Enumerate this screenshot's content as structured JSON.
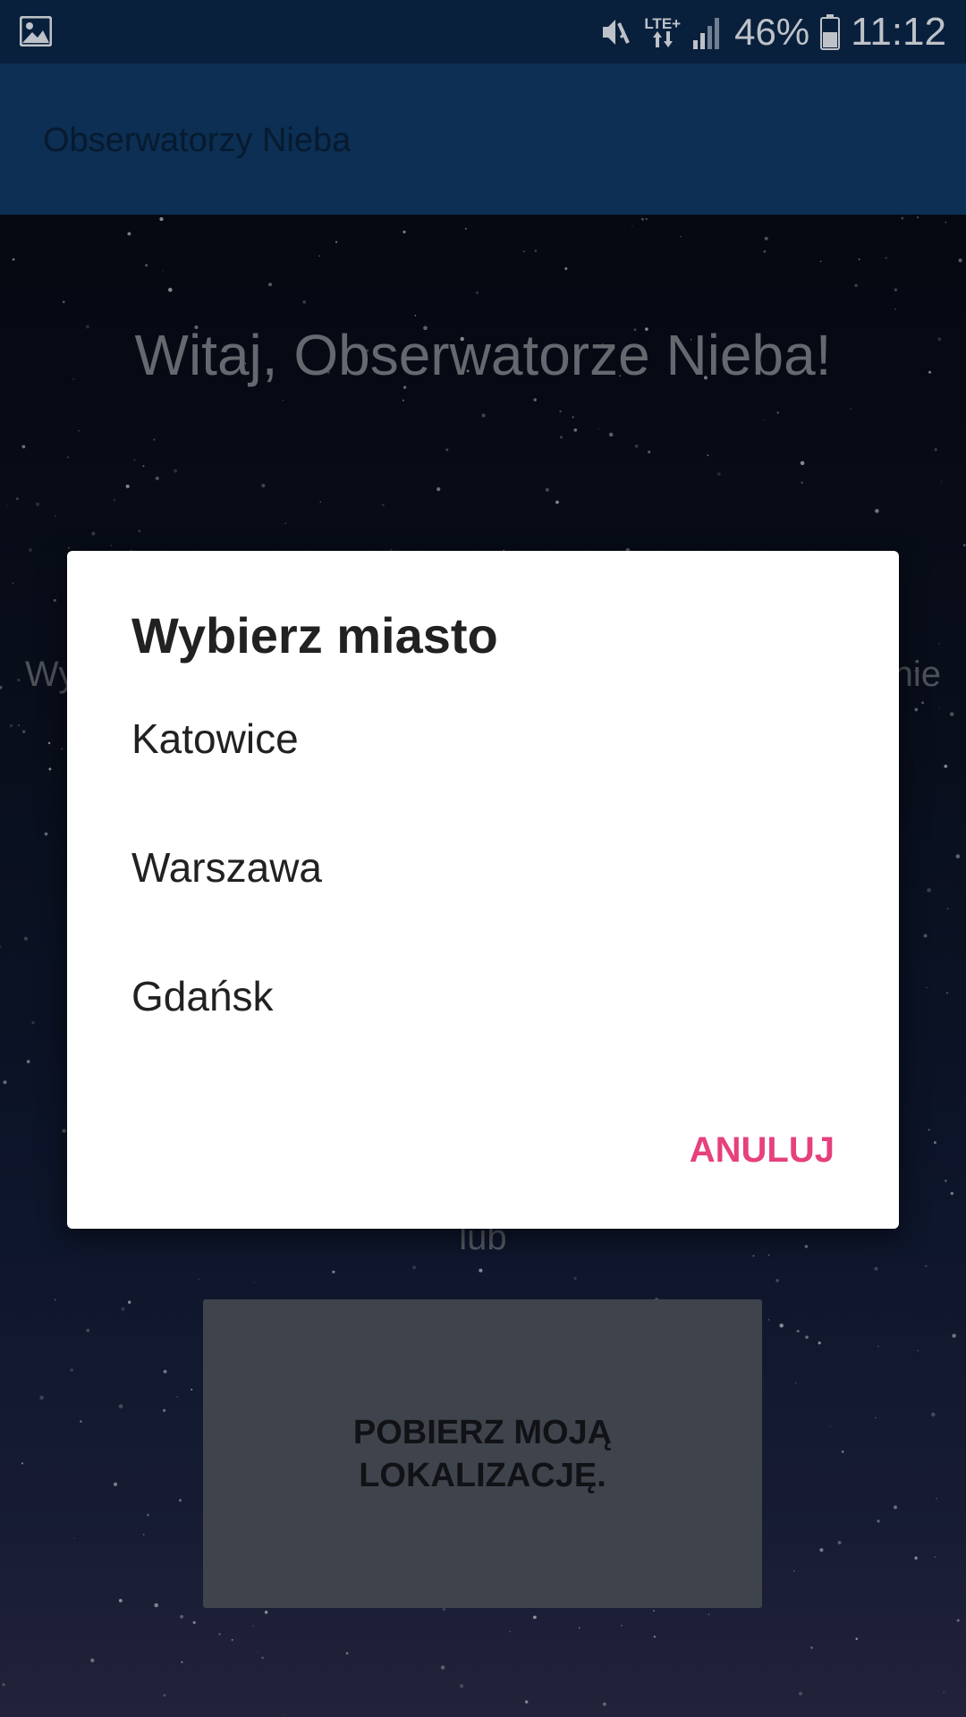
{
  "status_bar": {
    "network": "LTE+",
    "battery": "46%",
    "time": "11:12",
    "icons": [
      "gallery-icon",
      "mute-icon",
      "data-arrows-icon",
      "signal-icon",
      "battery-icon"
    ]
  },
  "app_bar": {
    "title": "Obserwatorzy Nieba"
  },
  "main": {
    "welcome": "Witaj, Obserwatorze Nieba!",
    "instruction_left": "Wy",
    "instruction_right": "nie",
    "or_label": "lub",
    "location_button_label": "POBIERZ MOJĄ LOKALIZACJĘ."
  },
  "dialog": {
    "title": "Wybierz miasto",
    "cities": [
      "Katowice",
      "Warszawa",
      "Gdańsk"
    ],
    "cancel_label": "ANULUJ",
    "accent_color": "#e6407d"
  }
}
